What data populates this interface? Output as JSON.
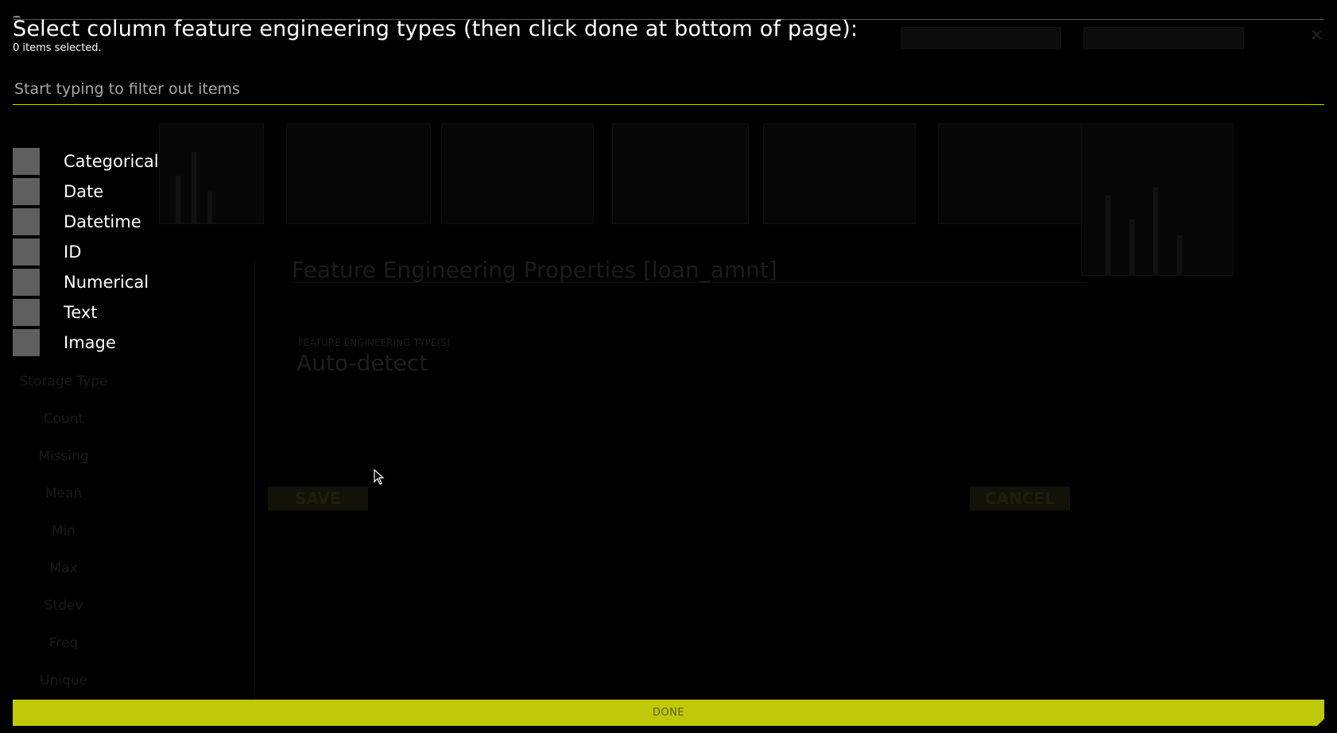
{
  "dialog": {
    "title": "Select column feature engineering types (then click done at bottom of page):",
    "selected_count": "0 items selected.",
    "filter_placeholder": "Start typing to filter out items",
    "options": [
      {
        "label": "Categorical",
        "checked": false
      },
      {
        "label": "Date",
        "checked": false
      },
      {
        "label": "Datetime",
        "checked": false
      },
      {
        "label": "ID",
        "checked": false
      },
      {
        "label": "Numerical",
        "checked": false
      },
      {
        "label": "Text",
        "checked": false
      },
      {
        "label": "Image",
        "checked": false
      }
    ],
    "done_label": "DONE"
  },
  "background": {
    "modal_title": "Feature Engineering Properties [loan_amnt]",
    "modal_field_label": "FEATURE ENGINEERING TYPE(S)",
    "modal_field_value": "Auto-detect",
    "save_label": "SAVE",
    "cancel_label": "CANCEL",
    "stats_labels": [
      "Storage Type",
      "Count",
      "Missing",
      "Mean",
      "Min",
      "Max",
      "Stdev",
      "Freq",
      "Unique"
    ]
  },
  "colors": {
    "accent": "#c0c80a",
    "checkbox": "#5f5f5f",
    "background": "#000000"
  }
}
